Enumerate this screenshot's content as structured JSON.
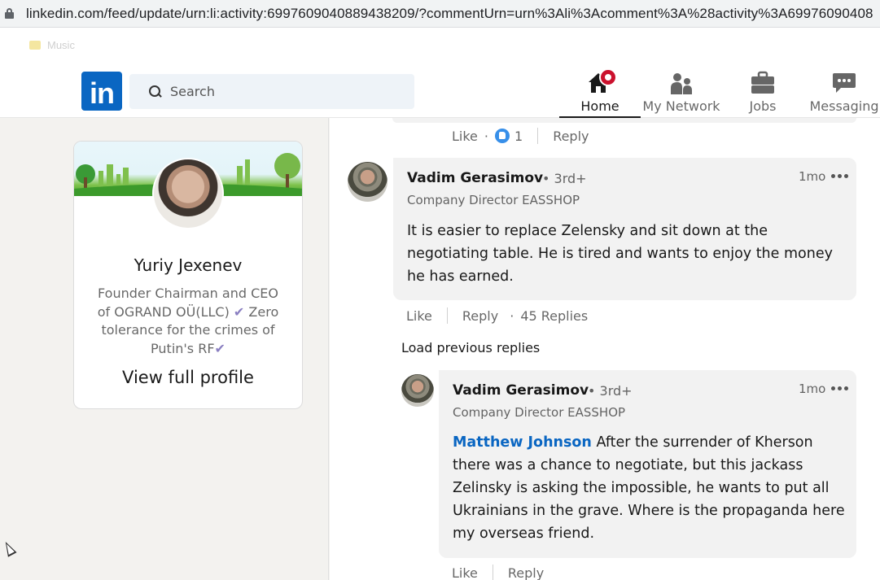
{
  "browser": {
    "url": "linkedin.com/feed/update/urn:li:activity:6997609040889438209/?commentUrn=urn%3Ali%3Acomment%3A%28activity%3A69976090408",
    "bookmarks": [
      "Music"
    ]
  },
  "header": {
    "logo_text": "in",
    "search_placeholder": "Search",
    "nav": [
      {
        "label": "Home",
        "icon": "home-icon",
        "active": true
      },
      {
        "label": "My Network",
        "icon": "network-icon"
      },
      {
        "label": "Jobs",
        "icon": "briefcase-icon"
      },
      {
        "label": "Messaging",
        "icon": "messaging-icon"
      }
    ]
  },
  "profile": {
    "name": "Yuriy Jexenev",
    "headline_1": "Founder Chairman and CEO of OGRAND OÜ(LLC)",
    "headline_2": "Zero tolerance for the crimes of Putin's RF",
    "check": "✔",
    "view_label": "View full profile"
  },
  "colors": {
    "brand": "#0a66c2",
    "badge": "#cb112d",
    "bubble": "#f2f2f2"
  },
  "thread": {
    "top_actions": {
      "like": "Like",
      "reaction_count": "1",
      "reply": "Reply"
    },
    "comment1": {
      "author": "Vadim Gerasimov",
      "degree": "• 3rd+",
      "title": "Company Director EASSHOP",
      "time": "1mo",
      "text": "It is easier to replace Zelensky and sit down at the negotiating table. He is tired and wants to enjoy the money he has earned.",
      "like": "Like",
      "reply": "Reply",
      "replies": "45 Replies"
    },
    "load_previous": "Load previous replies",
    "reply1": {
      "author": "Vadim Gerasimov",
      "degree": "• 3rd+",
      "title": "Company Director EASSHOP",
      "time": "1mo",
      "mention": "Matthew Johnson",
      "text": "After the surrender of Kherson there was a chance to negotiate, but this jackass Zelinsky is asking the impossible, he wants to put all Ukrainians in the grave. Where is the propaganda here my overseas friend.",
      "like": "Like",
      "reply": "Reply"
    }
  }
}
